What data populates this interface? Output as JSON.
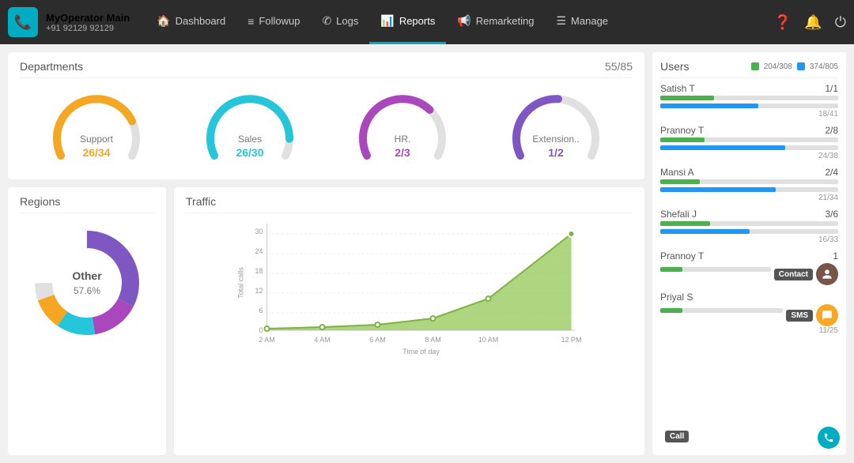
{
  "header": {
    "logo_name": "MyOperator Main",
    "logo_phone": "+91 92129 92129",
    "nav_items": [
      {
        "label": "Dashboard",
        "icon": "🏠",
        "active": false
      },
      {
        "label": "Followup",
        "icon": "☰",
        "active": false
      },
      {
        "label": "Logs",
        "icon": "📞",
        "active": false
      },
      {
        "label": "Reports",
        "icon": "📊",
        "active": true
      },
      {
        "label": "Remarketing",
        "icon": "📢",
        "active": false
      },
      {
        "label": "Manage",
        "icon": "☰",
        "active": false
      }
    ]
  },
  "departments": {
    "title": "Departments",
    "count": "55/85",
    "items": [
      {
        "name": "Support",
        "value": "26/34",
        "color": "#f5a623",
        "percent": 76
      },
      {
        "name": "Sales",
        "value": "26/30",
        "color": "#26c6da",
        "percent": 87
      },
      {
        "name": "HR.",
        "value": "2/3",
        "color": "#ab47bc",
        "percent": 67
      },
      {
        "name": "Extension..",
        "value": "1/2",
        "color": "#7e57c2",
        "percent": 50
      }
    ]
  },
  "regions": {
    "title": "Regions",
    "center_label": "Other",
    "center_value": "57.6%",
    "segments": [
      {
        "color": "#7e57c2",
        "percent": 57.6
      },
      {
        "color": "#ab47bc",
        "percent": 15
      },
      {
        "color": "#26c6da",
        "percent": 12
      },
      {
        "color": "#f5a623",
        "percent": 10
      },
      {
        "color": "#eee",
        "percent": 5.4
      }
    ]
  },
  "traffic": {
    "title": "Traffic",
    "y_label": "Total calls",
    "x_label": "Time of day",
    "x_ticks": [
      "2 AM",
      "4 AM",
      "6 AM",
      "8 AM",
      "10 AM",
      "12 PM"
    ],
    "y_ticks": [
      "0",
      "6",
      "12",
      "18",
      "24",
      "30"
    ]
  },
  "users": {
    "title": "Users",
    "legend": [
      {
        "color": "#4caf50",
        "label": "204/308"
      },
      {
        "color": "#2196f3",
        "label": "374/805"
      }
    ],
    "items": [
      {
        "name": "Satish T",
        "stat": "1/1",
        "green_pct": 30,
        "blue_pct": 55,
        "stat2": "18/41"
      },
      {
        "name": "Prannoy T",
        "stat": "2/8",
        "green_pct": 25,
        "blue_pct": 70,
        "stat2": "24/38"
      },
      {
        "name": "Mansi A",
        "stat": "2/4",
        "green_pct": 22,
        "blue_pct": 65,
        "stat2": "21/34"
      },
      {
        "name": "Shefali J",
        "stat": "3/6",
        "green_pct": 28,
        "blue_pct": 50,
        "stat2": "16/33"
      },
      {
        "name": "Prannoy T",
        "stat": "1",
        "green_pct": 20,
        "blue_pct": 0,
        "stat2": "",
        "has_contact": true
      },
      {
        "name": "Priyal S",
        "stat": "",
        "green_pct": 18,
        "blue_pct": 0,
        "stat2": "11/25",
        "has_sms": true
      }
    ]
  }
}
